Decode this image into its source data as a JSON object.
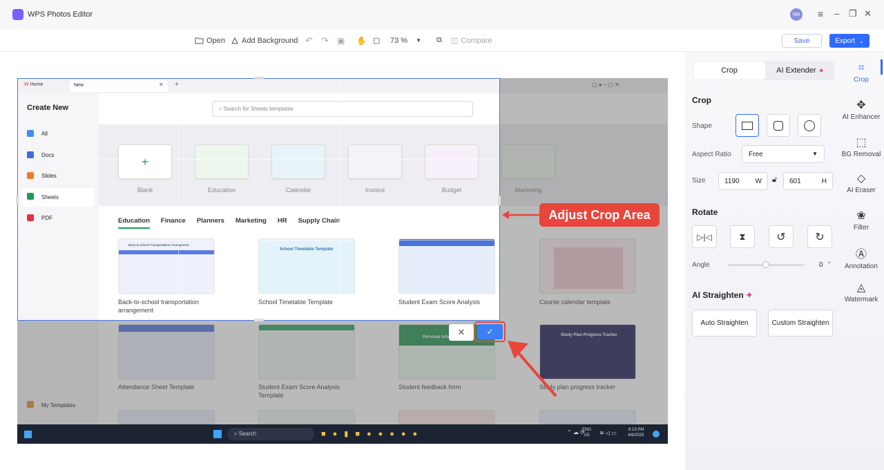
{
  "app": {
    "title": "WPS Photos Editor",
    "user_initials": "NN"
  },
  "window_controls": {
    "menu": "≡",
    "minimize": "–",
    "restore": "❐",
    "close": "✕"
  },
  "toolbar": {
    "open": "Open",
    "add_background": "Add Background",
    "zoom": "73 %",
    "compare": "Compare",
    "save": "Save",
    "export": "Export"
  },
  "panel": {
    "tabs": [
      "Crop",
      "AI Extender"
    ],
    "crop_title": "Crop",
    "shape_label": "Shape",
    "aspect_label": "Aspect Ratio",
    "aspect_value": "Free",
    "size_label": "Size",
    "width_value": "1190",
    "width_unit": "W",
    "height_value": "601",
    "height_unit": "H",
    "rotate_title": "Rotate",
    "angle_label": "Angle",
    "angle_value": "0",
    "angle_unit": "°",
    "angle_slider_fraction": 0.5,
    "straighten_title": "AI Straighten",
    "auto_straighten": "Auto Straighten",
    "custom_straighten": "Custom Straighten"
  },
  "rail": [
    {
      "label": "Crop",
      "icon": "crop-icon"
    },
    {
      "label": "AI Enhancer",
      "icon": "enhancer-icon"
    },
    {
      "label": "BG Removal",
      "icon": "bg-removal-icon"
    },
    {
      "label": "AI Eraser",
      "icon": "eraser-icon"
    },
    {
      "label": "Filter",
      "icon": "filter-icon"
    },
    {
      "label": "Annotation",
      "icon": "annotation-icon"
    },
    {
      "label": "Watermark",
      "icon": "watermark-icon"
    }
  ],
  "callout": {
    "text": "Adjust Crop Area"
  },
  "image": {
    "tabs": {
      "home": "Home",
      "new": "New"
    },
    "create_new": "Create New",
    "search_placeholder": "Search for Sheets templates",
    "nav": [
      "All",
      "Docs",
      "Slides",
      "Sheets",
      "PDF"
    ],
    "my_templates": "My Templates",
    "blank_cards": [
      "Blank",
      "Education",
      "Calendar",
      "Invoice",
      "Budget",
      "Marketing"
    ],
    "categories": [
      "Education",
      "Finance",
      "Planners",
      "Marketing",
      "HR",
      "Supply Chain"
    ],
    "row1": [
      {
        "caption": "Back-to-school transportation arrangement",
        "thumb": "Back-to-School Transportation Arrangement"
      },
      {
        "caption": "School Timetable Template",
        "thumb": "School Timetable Template"
      },
      {
        "caption": "Student Exam Score Analysis",
        "thumb": ""
      },
      {
        "caption": "Course calendar template",
        "thumb": ""
      }
    ],
    "row2": [
      {
        "caption": "Attendance Sheet Template",
        "thumb": ""
      },
      {
        "caption": "Student Exam Score Analysis Template",
        "thumb": ""
      },
      {
        "caption": "Student feedback form",
        "thumb": "Personal Information"
      },
      {
        "caption": "Study plan progress tracker",
        "thumb": "Study Plan Progress Tracker"
      }
    ],
    "taskbar": {
      "search": "Search",
      "lang": "ENG",
      "region": "US",
      "time": "6:13 PM",
      "date": "4/8/2025"
    }
  },
  "colors": {
    "accent": "#2f6bff",
    "callout": "#e8453c",
    "confirm": "#3d7ff5"
  }
}
